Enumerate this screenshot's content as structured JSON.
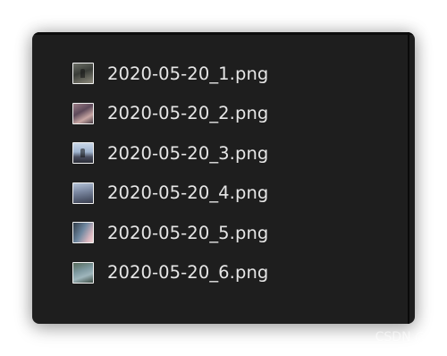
{
  "file_list": {
    "items": [
      {
        "name": "2020-05-20_1.png",
        "icon": "image-thumbnail-icon"
      },
      {
        "name": "2020-05-20_2.png",
        "icon": "image-thumbnail-icon"
      },
      {
        "name": "2020-05-20_3.png",
        "icon": "image-thumbnail-icon"
      },
      {
        "name": "2020-05-20_4.png",
        "icon": "image-thumbnail-icon"
      },
      {
        "name": "2020-05-20_5.png",
        "icon": "image-thumbnail-icon"
      },
      {
        "name": "2020-05-20_6.png",
        "icon": "image-thumbnail-icon"
      }
    ]
  },
  "watermark": {
    "text": "CSDN @全"
  },
  "colors": {
    "window_background": "#1e1e1e",
    "text": "#e6e6e6",
    "thumbnail_border": "#f2f2f2"
  }
}
